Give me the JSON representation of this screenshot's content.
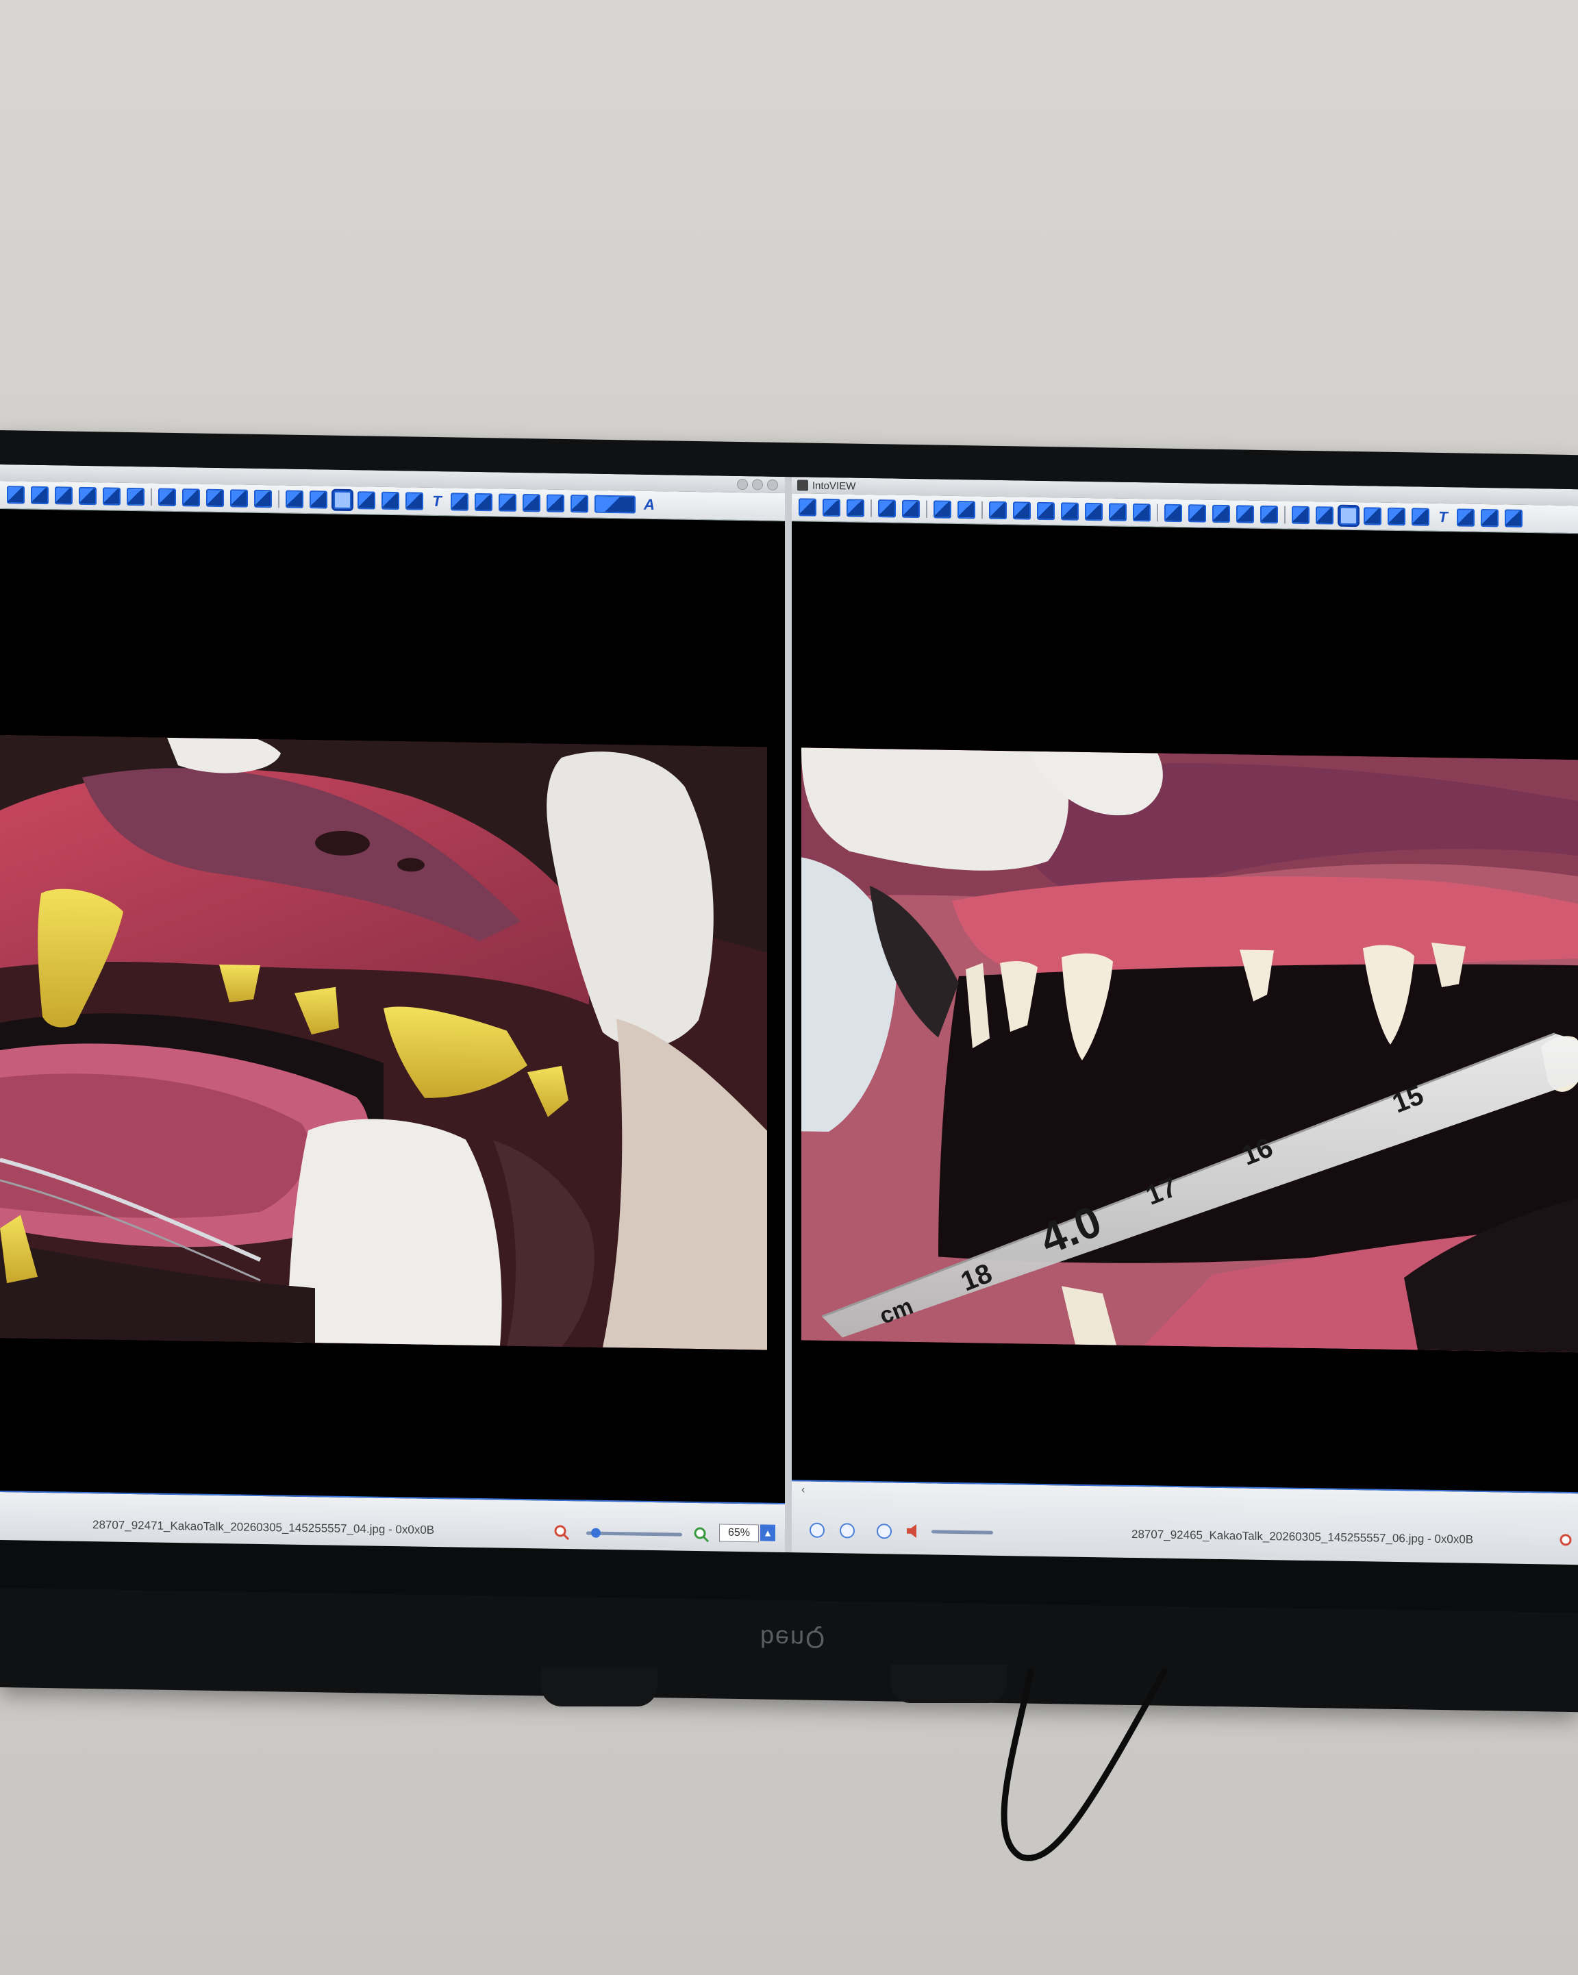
{
  "left_window": {
    "status_filename": "28707_92471_KakaoTalk_20260305_145255557_04.jpg - 0x0x0B",
    "zoom_value": "65%",
    "zoom_level": 0.1
  },
  "right_window": {
    "title": "IntoVIEW",
    "status_filename": "28707_92465_KakaoTalk_20260305_145255557_06.jpg - 0x0x0B"
  },
  "tube_markings": {
    "m15": "15",
    "m16": "16",
    "m17": "17",
    "size": "4.0",
    "m18": "18",
    "unit": "cm"
  },
  "taskbar": {
    "icons": [
      "photos-icon",
      "file-explorer-icon",
      "edge-icon",
      "powerpoint-icon",
      "app-icon",
      "speedometer-icon",
      "image-viewer-icon",
      "intoview-icon"
    ]
  },
  "bezel": {
    "logo": "benQ"
  },
  "colors": {
    "toolbar_blue": "#1c5fd6",
    "status_accent": "#3a72d8"
  }
}
